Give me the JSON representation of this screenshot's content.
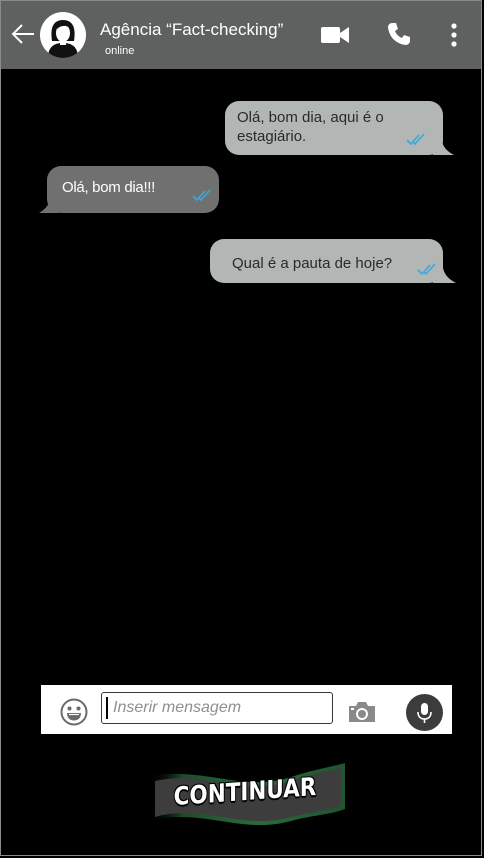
{
  "header": {
    "contact_name": "Agência “Fact-checking”",
    "status": "online",
    "icons": [
      "back-arrow-icon",
      "avatar-icon",
      "video-call-icon",
      "phone-icon",
      "more-vert-icon"
    ],
    "background": "#5e6160"
  },
  "messages": [
    {
      "direction": "outgoing",
      "lines": [
        "Olá, bom dia, aqui é o",
        "estagiário."
      ],
      "status": "read"
    },
    {
      "direction": "incoming",
      "lines": [
        "Olá, bom dia!!!"
      ],
      "status": "read"
    },
    {
      "direction": "outgoing",
      "lines": [
        "Qual é a pauta de hoje?"
      ],
      "status": "read"
    }
  ],
  "composer": {
    "placeholder": "Inserir mensagem",
    "value": "",
    "icons": [
      "emoji-icon",
      "camera-icon",
      "mic-icon"
    ]
  },
  "continue_button": {
    "label": "CONTINUAR",
    "color": "#2a6a3c"
  },
  "colors": {
    "outgoing_bubble": "#b2b6b5",
    "incoming_bubble": "#6f706f",
    "read_ticks": "#3aa8dc",
    "chat_background": "#000000"
  }
}
